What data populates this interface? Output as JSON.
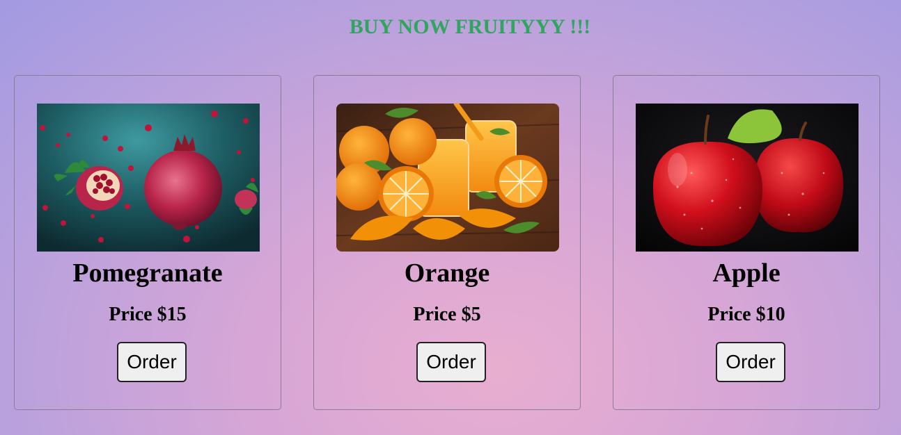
{
  "header": {
    "title": "BUY NOW FRUITYYY !!!"
  },
  "products": [
    {
      "name": "Pomegranate",
      "price": "Price $15",
      "button": "Order",
      "image": "pomegranate-image"
    },
    {
      "name": "Orange",
      "price": "Price $5",
      "button": "Order",
      "image": "orange-juice-image"
    },
    {
      "name": "Apple",
      "price": "Price $10",
      "button": "Order",
      "image": "apple-image"
    }
  ],
  "colors": {
    "title": "#2fa55d",
    "background_center": "#e8aed0",
    "background_edge": "#a29ae2"
  }
}
